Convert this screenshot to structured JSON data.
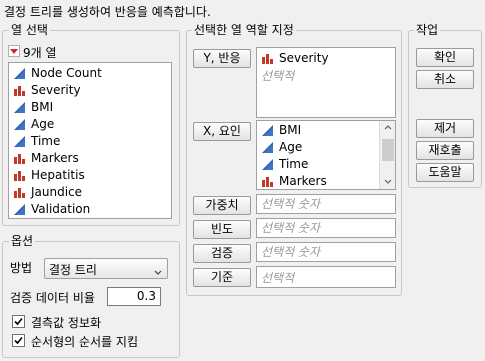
{
  "header": {
    "description": "결정 트리를 생성하여 반응을 예측합니다."
  },
  "column_select": {
    "title": "열 선택",
    "count_label": "9개 열",
    "items": [
      {
        "label": "Node Count",
        "icon": "continuous-icon"
      },
      {
        "label": "Severity",
        "icon": "nominal-icon"
      },
      {
        "label": "BMI",
        "icon": "continuous-icon"
      },
      {
        "label": "Age",
        "icon": "continuous-icon"
      },
      {
        "label": "Time",
        "icon": "continuous-icon"
      },
      {
        "label": "Markers",
        "icon": "nominal-icon"
      },
      {
        "label": "Hepatitis",
        "icon": "nominal-icon"
      },
      {
        "label": "Jaundice",
        "icon": "nominal-icon"
      },
      {
        "label": "Validation",
        "icon": "continuous-icon"
      }
    ]
  },
  "role_assign": {
    "title": "선택한 열 역할 지정",
    "y_button": "Y, 반응",
    "y_values": [
      {
        "label": "Severity",
        "icon": "nominal-icon"
      }
    ],
    "y_placeholder": "선택적",
    "x_button": "X, 요인",
    "x_values": [
      {
        "label": "BMI",
        "icon": "continuous-icon"
      },
      {
        "label": "Age",
        "icon": "continuous-icon"
      },
      {
        "label": "Time",
        "icon": "continuous-icon"
      },
      {
        "label": "Markers",
        "icon": "nominal-icon"
      }
    ],
    "weight_button": "가중치",
    "weight_placeholder": "선택적 숫자",
    "freq_button": "빈도",
    "freq_placeholder": "선택적 숫자",
    "validation_button": "검증",
    "validation_placeholder": "선택적 숫자",
    "by_button": "기준",
    "by_placeholder": "선택적"
  },
  "actions": {
    "title": "작업",
    "ok": "확인",
    "cancel": "취소",
    "remove": "제거",
    "recall": "재호출",
    "help": "도움말"
  },
  "options": {
    "title": "옵션",
    "method_label": "방법",
    "method_value": "결정 트리",
    "validation_ratio_label": "검증 데이터 비율",
    "validation_ratio_value": "0.3",
    "missing_info_label": "결측값 정보화",
    "missing_info_checked": true,
    "ordinal_label": "순서형의 순서를 지킴",
    "ordinal_checked": true
  },
  "colors": {
    "continuous": "#2b5fb4",
    "nominal": "#c0392b",
    "red_triangle": "#d9262e"
  }
}
